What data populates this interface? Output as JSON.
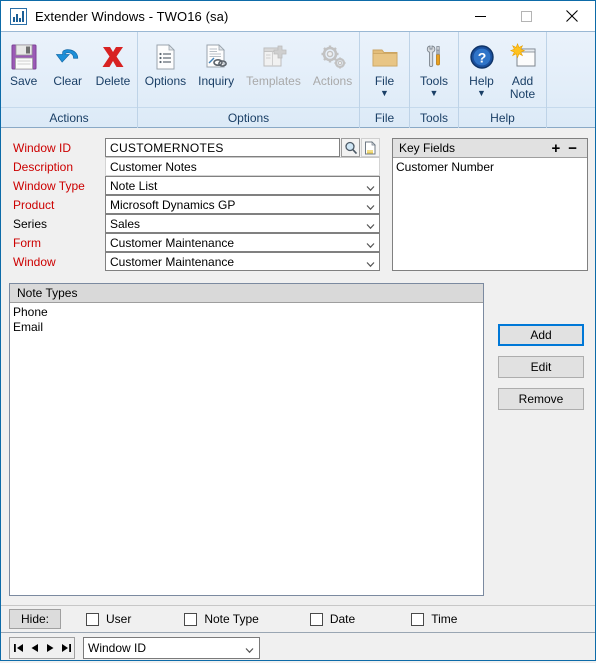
{
  "window": {
    "app_icon": "chart-icon",
    "title": "Extender Windows  -  TWO16 (sa)",
    "minimize": "minimize-icon",
    "maximize": "maximize-icon",
    "close": "close-icon"
  },
  "ribbon": {
    "groups": [
      {
        "label": "Actions",
        "buttons": [
          {
            "label": "Save",
            "icon": "save-floppy-icon",
            "disabled": false,
            "caret": false
          },
          {
            "label": "Clear",
            "icon": "undo-arrow-icon",
            "disabled": false,
            "caret": false
          },
          {
            "label": "Delete",
            "icon": "red-x-icon",
            "disabled": false,
            "caret": false
          }
        ]
      },
      {
        "label": "Options",
        "buttons": [
          {
            "label": "Options",
            "icon": "document-list-icon",
            "disabled": false,
            "caret": false
          },
          {
            "label": "Inquiry",
            "icon": "document-link-icon",
            "disabled": false,
            "caret": false
          },
          {
            "label": "Templates",
            "icon": "template-plus-icon",
            "disabled": true,
            "caret": false
          },
          {
            "label": "Actions",
            "icon": "gears-icon",
            "disabled": true,
            "caret": false
          }
        ]
      },
      {
        "label": "File",
        "buttons": [
          {
            "label": "File",
            "icon": "folder-icon",
            "disabled": false,
            "caret": true
          }
        ]
      },
      {
        "label": "Tools",
        "buttons": [
          {
            "label": "Tools",
            "icon": "wrench-screwdriver-icon",
            "disabled": false,
            "caret": true
          }
        ]
      },
      {
        "label": "Help",
        "buttons": [
          {
            "label": "Help",
            "icon": "blue-question-icon",
            "disabled": false,
            "caret": true
          },
          {
            "label": "Add\nNote",
            "icon": "add-note-icon",
            "disabled": false,
            "caret": false
          }
        ]
      }
    ]
  },
  "form": {
    "fields": [
      {
        "label": "Window ID",
        "value": "CUSTOMERNOTES",
        "required": true,
        "type": "lookup"
      },
      {
        "label": "Description",
        "value": "Customer Notes",
        "required": true,
        "type": "text"
      },
      {
        "label": "Window Type",
        "value": "Note List",
        "required": true,
        "type": "combo"
      },
      {
        "label": "Product",
        "value": "Microsoft Dynamics GP",
        "required": true,
        "type": "combo"
      },
      {
        "label": "Series",
        "value": "Sales",
        "required": false,
        "type": "combo"
      },
      {
        "label": "Form",
        "value": "Customer Maintenance",
        "required": true,
        "type": "combo"
      },
      {
        "label": "Window",
        "value": "Customer Maintenance",
        "required": true,
        "type": "combo"
      }
    ],
    "lookup_icon": "magnifier-lookup-icon",
    "note_icon": "note-page-icon"
  },
  "key_fields": {
    "title": "Key Fields",
    "add_label": "+",
    "remove_label": "−",
    "items": [
      "Customer Number"
    ]
  },
  "note_types": {
    "title": "Note Types",
    "items": [
      "Phone",
      "Email"
    ]
  },
  "side_buttons": [
    {
      "label": "Add",
      "focused": true
    },
    {
      "label": "Edit",
      "focused": false
    },
    {
      "label": "Remove",
      "focused": false
    }
  ],
  "hide_bar": {
    "label": "Hide:",
    "checkboxes": [
      {
        "label": "User",
        "checked": false
      },
      {
        "label": "Note Type",
        "checked": false
      },
      {
        "label": "Date",
        "checked": false
      },
      {
        "label": "Time",
        "checked": false
      }
    ]
  },
  "status_bar": {
    "nav": [
      "first-record-icon",
      "previous-record-icon",
      "next-record-icon",
      "last-record-icon"
    ],
    "browse_by": "Window ID"
  },
  "colors": {
    "required_label": "#cc0000",
    "ribbon_text": "#1a3f66",
    "focus_border": "#0078d7",
    "window_border": "#0d6ba8"
  }
}
